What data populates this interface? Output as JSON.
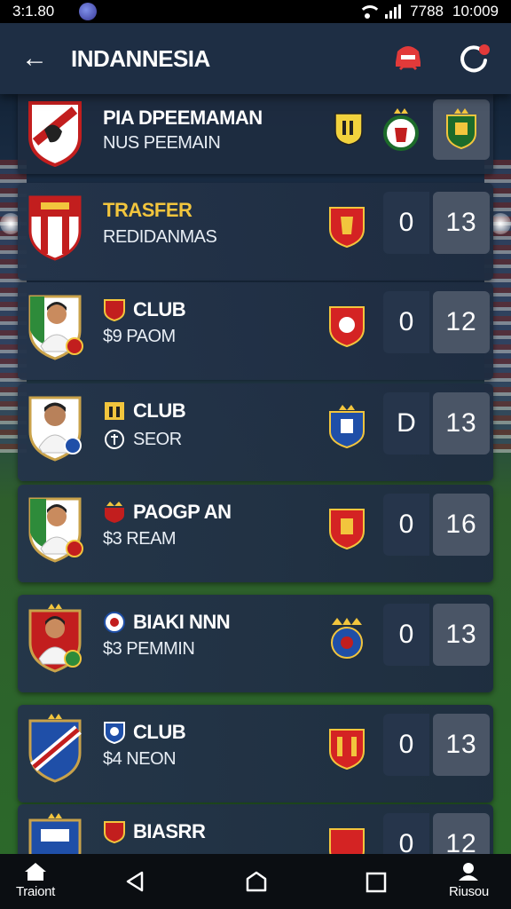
{
  "status_bar": {
    "time": "3:1.80",
    "battery": "7788",
    "clock": "10:009"
  },
  "header": {
    "title": "INDANNESIA"
  },
  "colors": {
    "accent_gold": "#f2c53d",
    "score_box": "#4a5566",
    "card_bg": "#24344a",
    "notification_dot": "#e23a3a"
  },
  "items": [
    {
      "line1": "PIA DPEEMAMAN",
      "line2": "NUS PEEMAIN",
      "score_left": "",
      "score_right": "",
      "highlight": false
    },
    {
      "line1": "TRASFER",
      "line2": "REDIDANMAS",
      "score_left": "0",
      "score_right": "13",
      "highlight": true
    },
    {
      "line1": "CLUB",
      "line2": "$9  PAOM",
      "score_left": "0",
      "score_right": "12",
      "highlight": false
    },
    {
      "line1": "CLUB",
      "line2": "SEOR",
      "score_left": "D",
      "score_right": "13",
      "highlight": false
    },
    {
      "line1": "PAOGP AN",
      "line2": "$3  REAM",
      "score_left": "0",
      "score_right": "16",
      "highlight": false
    },
    {
      "line1": "BIAKI NNN",
      "line2": "$3  PEMMIN",
      "score_left": "0",
      "score_right": "13",
      "highlight": false
    },
    {
      "line1": "CLUB",
      "line2": "$4  NEON",
      "score_left": "0",
      "score_right": "13",
      "highlight": false
    },
    {
      "line1": "BIASRR",
      "line2": "",
      "score_left": "0",
      "score_right": "12",
      "highlight": false
    }
  ],
  "bottom_nav": {
    "left_label": "Traiont",
    "right_label": "Riusou"
  }
}
